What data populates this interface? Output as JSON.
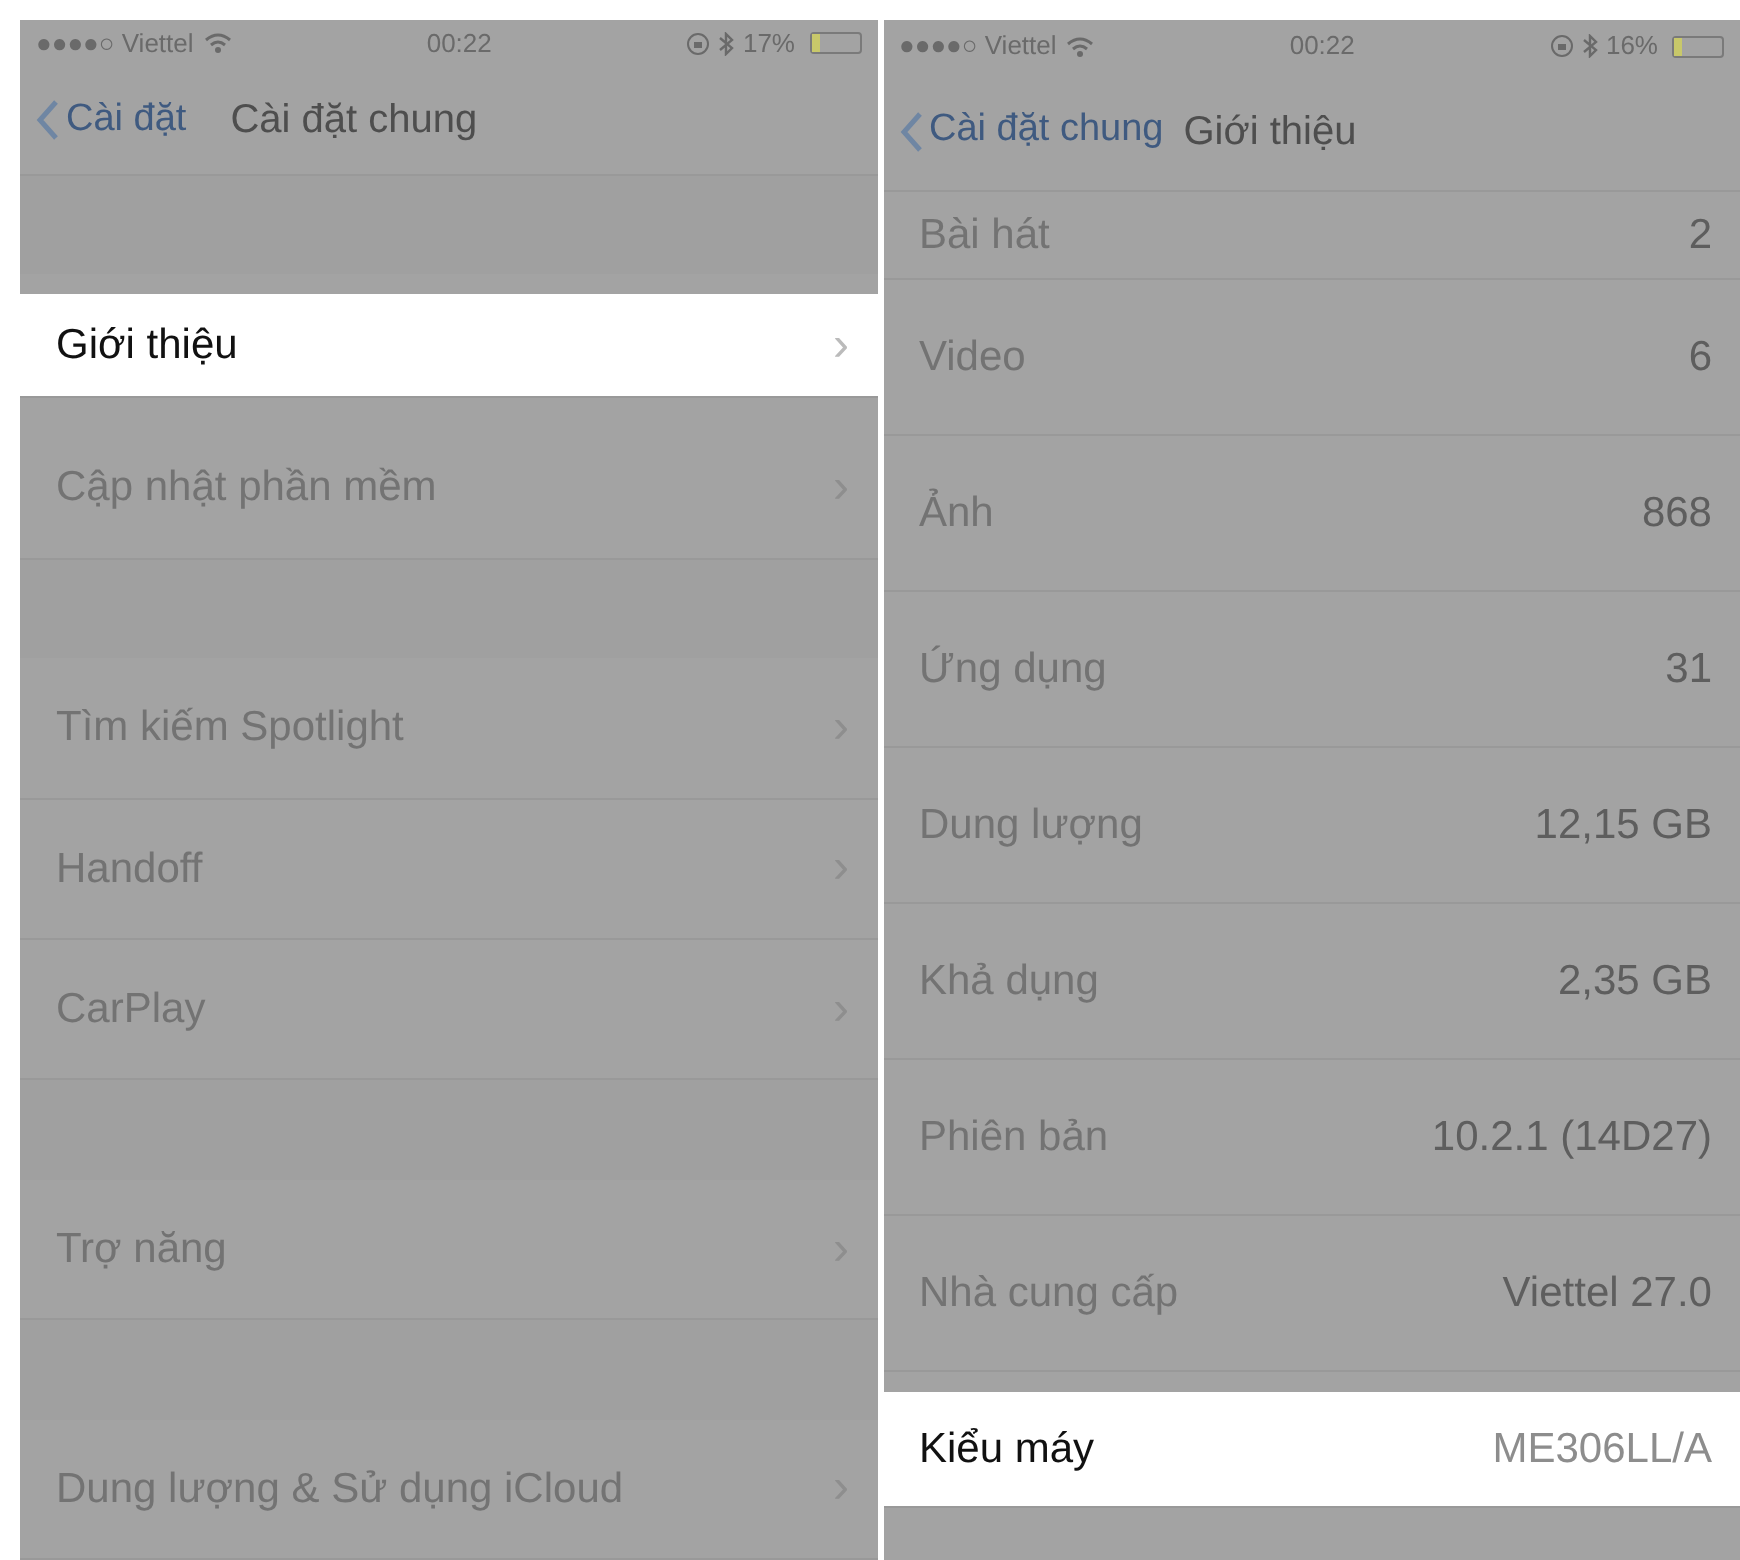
{
  "panels": [
    {
      "status_bar": {
        "carrier": "●●●●○ Viettel",
        "time": "00:22",
        "battery": "17%"
      },
      "nav": {
        "back": "Cài đặt",
        "title": "Cài đặt chung"
      },
      "items": [
        {
          "kind": "gap"
        },
        {
          "kind": "row",
          "label": "Giới thiệu",
          "chevron": "›",
          "highlighted": true
        },
        {
          "kind": "row",
          "label": "Cập nhật phần mềm",
          "chevron": "›",
          "highlighted": false
        },
        {
          "kind": "gap"
        },
        {
          "kind": "row",
          "label": "Tìm kiếm Spotlight",
          "chevron": "›",
          "highlighted": false
        },
        {
          "kind": "row",
          "label": "Handoff",
          "chevron": "›",
          "highlighted": false
        },
        {
          "kind": "row",
          "label": "CarPlay",
          "chevron": "›",
          "highlighted": false
        },
        {
          "kind": "gap"
        },
        {
          "kind": "row",
          "label": "Trợ năng",
          "chevron": "›",
          "highlighted": false
        },
        {
          "kind": "gap"
        },
        {
          "kind": "row",
          "label": "Dung lượng & Sử dụng iCloud",
          "chevron": "›",
          "highlighted": false
        }
      ]
    },
    {
      "status_bar": {
        "carrier": "●●●●○ Viettel",
        "time": "00:22",
        "battery": "16%"
      },
      "nav": {
        "back": "Cài đặt chung",
        "title": "Giới thiệu"
      },
      "items": [
        {
          "kind": "info",
          "label": "Bài hát",
          "value": "2",
          "highlighted": false
        },
        {
          "kind": "info",
          "label": "Video",
          "value": "6",
          "highlighted": false
        },
        {
          "kind": "info",
          "label": "Ảnh",
          "value": "868",
          "highlighted": false
        },
        {
          "kind": "info",
          "label": "Ứng dụng",
          "value": "31",
          "highlighted": false
        },
        {
          "kind": "info",
          "label": "Dung lượng",
          "value": "12,15 GB",
          "highlighted": false
        },
        {
          "kind": "info",
          "label": "Khả dụng",
          "value": "2,35 GB",
          "highlighted": false
        },
        {
          "kind": "info",
          "label": "Phiên bản",
          "value": "10.2.1 (14D27)",
          "highlighted": false
        },
        {
          "kind": "info",
          "label": "Nhà cung cấp",
          "value": "Viettel 27.0",
          "highlighted": false
        },
        {
          "kind": "info",
          "label": "Kiểu máy",
          "value": "ME306LL/A",
          "highlighted": true
        }
      ]
    }
  ]
}
